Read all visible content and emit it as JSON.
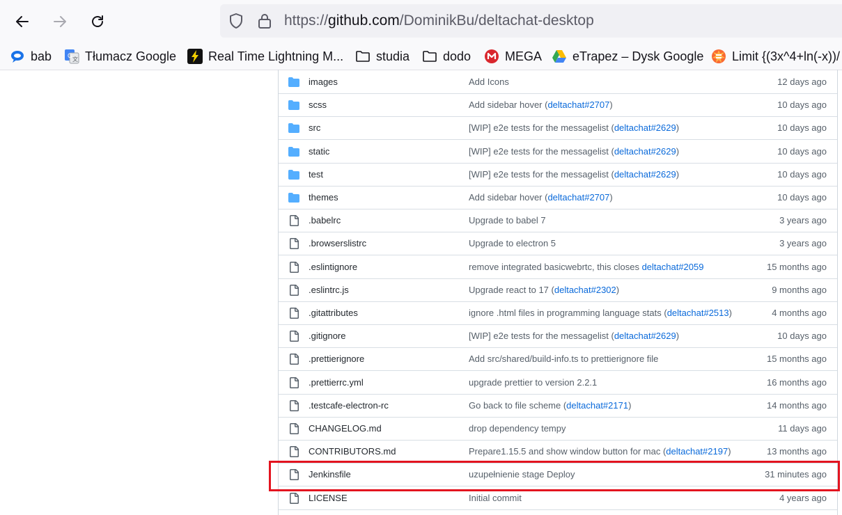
{
  "browser": {
    "url_prefix": "https://",
    "url_domain": "github.com",
    "url_path": "/DominikBu/deltachat-desktop"
  },
  "bookmarks": [
    {
      "label": "bab",
      "icon": "speech-bubble-icon"
    },
    {
      "label": "Tłumacz Google",
      "icon": "google-translate-icon"
    },
    {
      "label": "Real Time Lightning M...",
      "icon": "lightning-icon"
    },
    {
      "label": "studia",
      "icon": "folder-icon"
    },
    {
      "label": "dodo",
      "icon": "folder-icon"
    },
    {
      "label": "MEGA",
      "icon": "mega-icon"
    },
    {
      "label": "eTrapez – Dysk Google",
      "icon": "google-drive-icon"
    },
    {
      "label": "Limit {(3x^4+ln(-x))/",
      "icon": "wolfram-icon"
    }
  ],
  "files": [
    {
      "type": "dir",
      "name": "images",
      "msg": "Add Icons",
      "link": "",
      "suffix": "",
      "age": "12 days ago"
    },
    {
      "type": "dir",
      "name": "scss",
      "msg": "Add sidebar hover (",
      "link": "deltachat#2707",
      "suffix": ")",
      "age": "10 days ago"
    },
    {
      "type": "dir",
      "name": "src",
      "msg": "[WIP] e2e tests for the messagelist (",
      "link": "deltachat#2629",
      "suffix": ")",
      "age": "10 days ago"
    },
    {
      "type": "dir",
      "name": "static",
      "msg": "[WIP] e2e tests for the messagelist (",
      "link": "deltachat#2629",
      "suffix": ")",
      "age": "10 days ago"
    },
    {
      "type": "dir",
      "name": "test",
      "msg": "[WIP] e2e tests for the messagelist (",
      "link": "deltachat#2629",
      "suffix": ")",
      "age": "10 days ago"
    },
    {
      "type": "dir",
      "name": "themes",
      "msg": "Add sidebar hover (",
      "link": "deltachat#2707",
      "suffix": ")",
      "age": "10 days ago"
    },
    {
      "type": "file",
      "name": ".babelrc",
      "msg": "Upgrade to babel 7",
      "link": "",
      "suffix": "",
      "age": "3 years ago"
    },
    {
      "type": "file",
      "name": ".browserslistrc",
      "msg": "Upgrade to electron 5",
      "link": "",
      "suffix": "",
      "age": "3 years ago"
    },
    {
      "type": "file",
      "name": ".eslintignore",
      "msg": "remove integrated basicwebrtc, this closes ",
      "link": "deltachat#2059",
      "suffix": "",
      "age": "15 months ago"
    },
    {
      "type": "file",
      "name": ".eslintrc.js",
      "msg": "Upgrade react to 17 (",
      "link": "deltachat#2302",
      "suffix": ")",
      "age": "9 months ago"
    },
    {
      "type": "file",
      "name": ".gitattributes",
      "msg": "ignore .html files in programming language stats (",
      "link": "deltachat#2513",
      "suffix": ")",
      "age": "4 months ago"
    },
    {
      "type": "file",
      "name": ".gitignore",
      "msg": "[WIP] e2e tests for the messagelist (",
      "link": "deltachat#2629",
      "suffix": ")",
      "age": "10 days ago"
    },
    {
      "type": "file",
      "name": ".prettierignore",
      "msg": "Add src/shared/build-info.ts to prettierignore file",
      "link": "",
      "suffix": "",
      "age": "15 months ago"
    },
    {
      "type": "file",
      "name": ".prettierrc.yml",
      "msg": "upgrade prettier to version 2.2.1",
      "link": "",
      "suffix": "",
      "age": "16 months ago"
    },
    {
      "type": "file",
      "name": ".testcafe-electron-rc",
      "msg": "Go back to file scheme (",
      "link": "deltachat#2171",
      "suffix": ")",
      "age": "14 months ago"
    },
    {
      "type": "file",
      "name": "CHANGELOG.md",
      "msg": "drop dependency tempy",
      "link": "",
      "suffix": "",
      "age": "11 days ago"
    },
    {
      "type": "file",
      "name": "CONTRIBUTORS.md",
      "msg": "Prepare1.15.5 and show window button for mac (",
      "link": "deltachat#2197",
      "suffix": ")",
      "age": "13 months ago"
    },
    {
      "type": "file",
      "name": "Jenkinsfile",
      "msg": "uzupełnienie stage Deploy",
      "link": "",
      "suffix": "",
      "age": "31 minutes ago"
    },
    {
      "type": "file",
      "name": "LICENSE",
      "msg": "Initial commit",
      "link": "",
      "suffix": "",
      "age": "4 years ago"
    }
  ],
  "colors": {
    "folder": "#54aeff",
    "link": "#0969da",
    "highlight": "#e3141f"
  }
}
